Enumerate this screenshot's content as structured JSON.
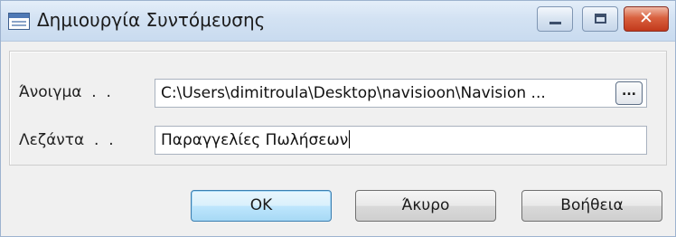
{
  "window": {
    "title": "Δημιουργία Συντόμευσης",
    "close_glyph": "✕"
  },
  "form": {
    "open_label": "Άνοιγμα  .  .",
    "open_value": "C:\\Users\\dimitroula\\Desktop\\navisioon\\Navision ...",
    "browse_label": "...",
    "caption_label": "Λεζάντα  .  .",
    "caption_value": "Παραγγελίες Πωλήσεων"
  },
  "buttons": {
    "ok": "OK",
    "cancel": "Άκυρο",
    "help": "Βοήθεια"
  },
  "icons": {
    "app": "window-icon",
    "minimize": "minimize-icon",
    "maximize": "maximize-icon",
    "close": "close-icon"
  }
}
